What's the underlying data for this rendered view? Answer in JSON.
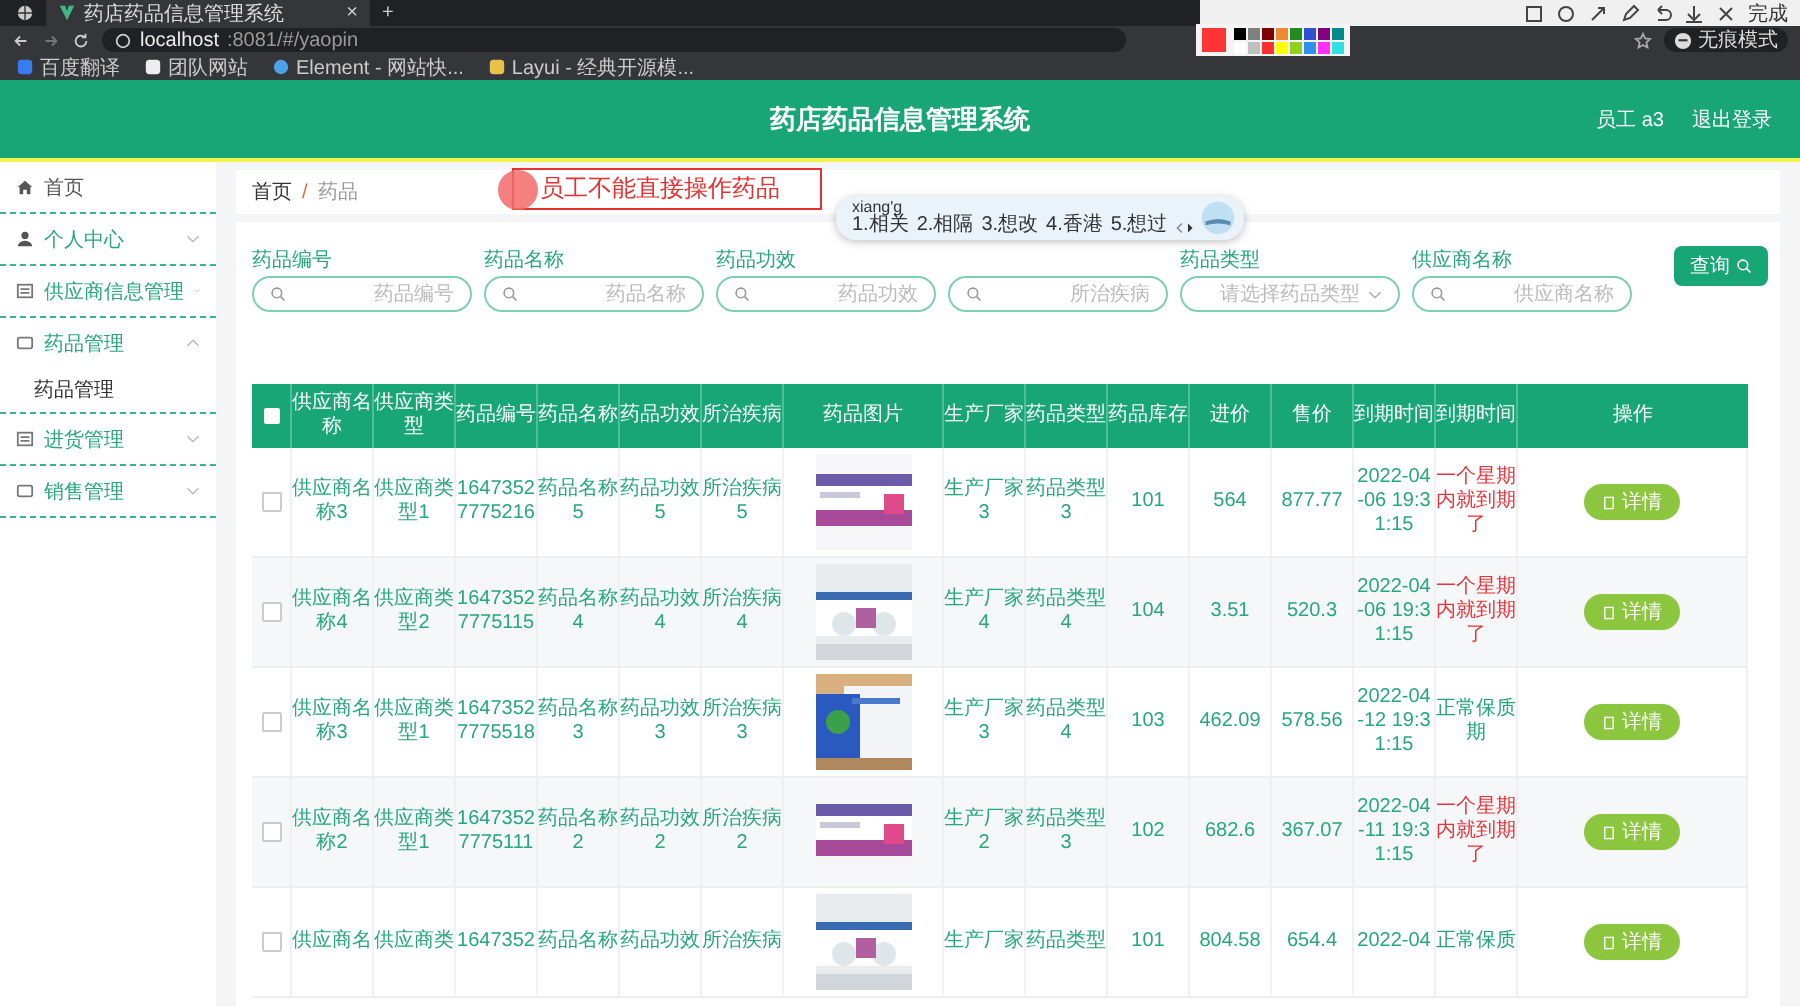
{
  "browser": {
    "tab_title": "药店药品信息管理系统",
    "tab_close": "×",
    "new_tab": "+",
    "url_host": "localhost",
    "url_path": ":8081/#/yaopin",
    "bookmarks": [
      "百度翻译",
      "团队网站",
      "Element - 网站快...",
      "Layui - 经典开源模..."
    ],
    "profile": "无痕模式"
  },
  "capture_toolbar": {
    "done": "完成",
    "current_swatch": {
      "color": "#ff3535"
    },
    "swatches": [
      {
        "color": "#000000"
      },
      {
        "color": "#808080"
      },
      {
        "color": "#800000"
      },
      {
        "color": "#f08a30"
      },
      {
        "color": "#228b22"
      },
      {
        "color": "#3050d0"
      },
      {
        "color": "#800080"
      },
      {
        "color": "#008b8b"
      },
      {
        "color": "#ffffff"
      },
      {
        "color": "#c0c0c0"
      },
      {
        "color": "#ff3030"
      },
      {
        "color": "#ffff00"
      },
      {
        "color": "#90d020"
      },
      {
        "color": "#3090f0"
      },
      {
        "color": "#ff30ff"
      },
      {
        "color": "#30e0e0"
      }
    ]
  },
  "header": {
    "title": "药店药品信息管理系统",
    "user": "员工 a3",
    "logout": "退出登录"
  },
  "sidebar": {
    "items": [
      {
        "label": "首页"
      },
      {
        "label": "个人中心",
        "expanded": false
      },
      {
        "label": "供应商信息管理",
        "expanded": false
      },
      {
        "label": "药品管理",
        "expanded": true,
        "children": [
          {
            "label": "药品管理"
          }
        ]
      },
      {
        "label": "进货管理",
        "expanded": false
      },
      {
        "label": "销售管理",
        "expanded": false
      }
    ]
  },
  "breadcrumb": {
    "items": [
      "首页",
      "药品"
    ],
    "separator": "/"
  },
  "annotation": {
    "text": "员工不能直接操作药品"
  },
  "ime": {
    "input": "xiang'g",
    "candidates": [
      "1.相关",
      "2.相隔",
      "3.想改",
      "4.香港",
      "5.想过"
    ]
  },
  "search": {
    "fields": [
      {
        "label": "药品编号",
        "placeholder": "药品编号",
        "kind": "text"
      },
      {
        "label": "药品名称",
        "placeholder": "药品名称",
        "kind": "text"
      },
      {
        "label": "药品功效",
        "placeholder": "药品功效",
        "kind": "text"
      },
      {
        "placeholder": "所治疾病",
        "kind": "text"
      },
      {
        "label": "药品类型",
        "placeholder": "请选择药品类型",
        "kind": "select"
      },
      {
        "label": "供应商名称",
        "placeholder": "供应商名称",
        "kind": "text"
      }
    ],
    "button": "查询"
  },
  "table": {
    "header_checked": false,
    "columns": [
      "供应商名称",
      "供应商类型",
      "药品编号",
      "药品名称",
      "药品功效",
      "所治疾病",
      "药品图片",
      "生产厂家",
      "药品类型",
      "药品库存",
      "进价",
      "售价",
      "到期时间",
      "到期时间",
      "操作"
    ],
    "rows": [
      {
        "checked": false,
        "supplier": "供应商名称3",
        "supplier_type": "供应商类型1",
        "code": "16473527775216",
        "name": "药品名称5",
        "effect": "药品功效5",
        "disease": "所治疾病5",
        "maker": "生产厂家3",
        "drug_type": "药品类型3",
        "stock": "101",
        "cost": "564",
        "price": "877.77",
        "expiry": "2022-04-06 19:31:15",
        "status": {
          "text": "一个星期内就到期了",
          "kind": "warning"
        },
        "action": "详情"
      },
      {
        "checked": false,
        "supplier": "供应商名称4",
        "supplier_type": "供应商类型2",
        "code": "16473527775115",
        "name": "药品名称4",
        "effect": "药品功效4",
        "disease": "所治疾病4",
        "maker": "生产厂家4",
        "drug_type": "药品类型4",
        "stock": "104",
        "cost": "3.51",
        "price": "520.3",
        "expiry": "2022-04-06 19:31:15",
        "status": {
          "text": "一个星期内就到期了",
          "kind": "warning"
        },
        "action": "详情"
      },
      {
        "checked": false,
        "supplier": "供应商名称3",
        "supplier_type": "供应商类型1",
        "code": "16473527775518",
        "name": "药品名称3",
        "effect": "药品功效3",
        "disease": "所治疾病3",
        "maker": "生产厂家3",
        "drug_type": "药品类型4",
        "stock": "103",
        "cost": "462.09",
        "price": "578.56",
        "expiry": "2022-04-12 19:31:15",
        "status": {
          "text": "正常保质期",
          "kind": "normal"
        },
        "action": "详情"
      },
      {
        "checked": false,
        "supplier": "供应商名称2",
        "supplier_type": "供应商类型1",
        "code": "16473527775111",
        "name": "药品名称2",
        "effect": "药品功效2",
        "disease": "所治疾病2",
        "maker": "生产厂家2",
        "drug_type": "药品类型3",
        "stock": "102",
        "cost": "682.6",
        "price": "367.07",
        "expiry": "2022-04-11 19:31:15",
        "status": {
          "text": "一个星期内就到期了",
          "kind": "warning"
        },
        "action": "详情"
      },
      {
        "checked": false,
        "supplier": "供应商名",
        "supplier_type": "供应商类",
        "code": "1647352",
        "name": "药品名称",
        "effect": "药品功效",
        "disease": "所治疾病",
        "maker": "生产厂家",
        "drug_type": "药品类型",
        "stock": "101",
        "cost": "804.58",
        "price": "654.4",
        "expiry": "2022-04",
        "status": {
          "text": "正常保质",
          "kind": "normal"
        },
        "action": "详情"
      }
    ]
  }
}
